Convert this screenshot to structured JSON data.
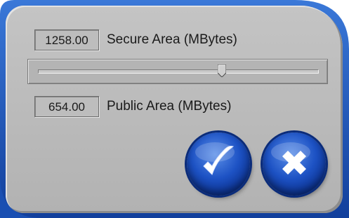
{
  "secure": {
    "value": "1258.00",
    "label": "Secure Area (MBytes)"
  },
  "public": {
    "value": "654.00",
    "label": "Public Area (MBytes)"
  },
  "slider": {
    "fraction": 0.658
  },
  "buttons": {
    "ok_icon": "checkmark-icon",
    "cancel_icon": "x-icon"
  },
  "colors": {
    "frame": "#1e5cbf",
    "panel": "#bebebe",
    "button": "#1d52c4"
  }
}
